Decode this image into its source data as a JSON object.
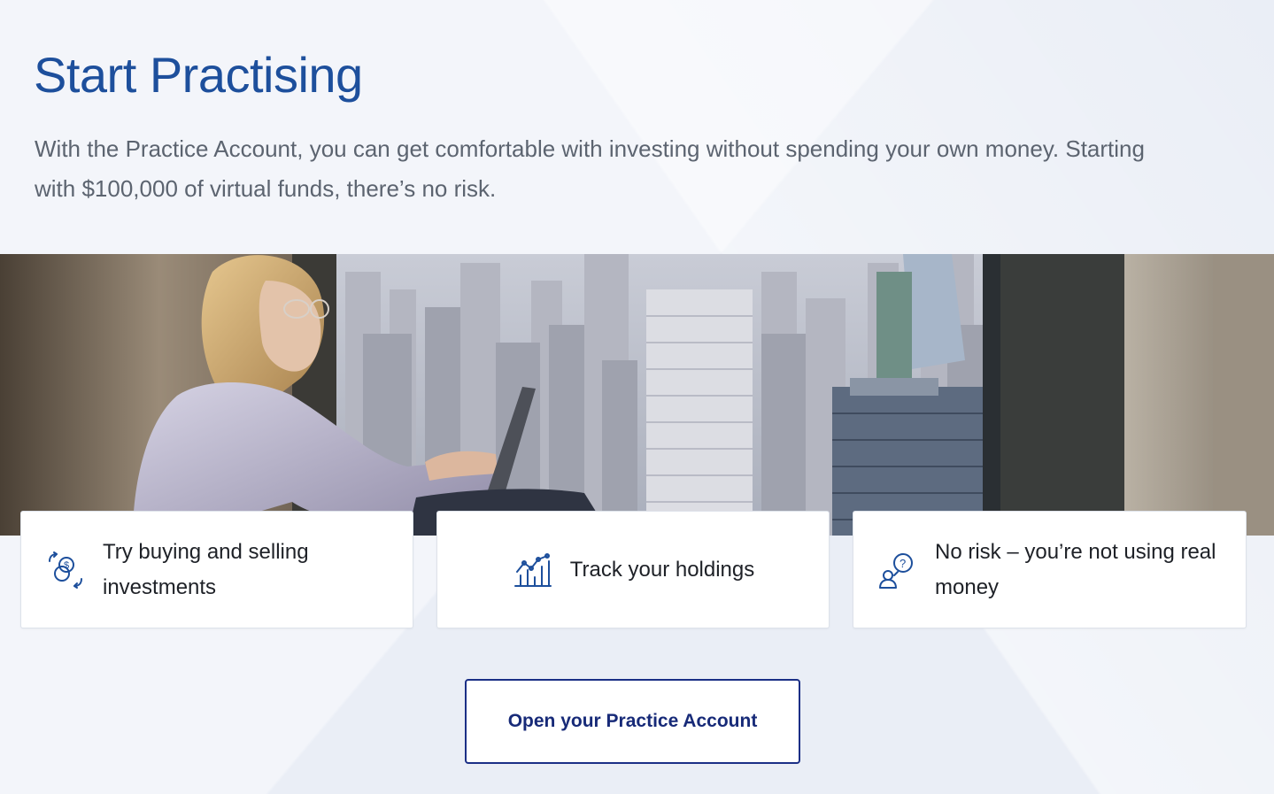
{
  "header": {
    "title": "Start Practising",
    "description": "With the Practice Account, you can get comfortable with investing without spending your own money. Starting with $100,000 of virtual funds, there’s no risk."
  },
  "hero_image": {
    "icon": "woman-with-laptop-city-view-photo"
  },
  "features": [
    {
      "label": "Try buying and selling investments",
      "icon": "exchange-currency-icon"
    },
    {
      "label": "Track your holdings",
      "icon": "growth-chart-icon"
    },
    {
      "label": "No risk – you’re not using real money",
      "icon": "person-question-icon"
    }
  ],
  "cta": {
    "label": "Open your Practice Account"
  },
  "colors": {
    "brand_blue": "#1d4f9c",
    "button_navy": "#172a78",
    "background": "#eef1f7"
  }
}
